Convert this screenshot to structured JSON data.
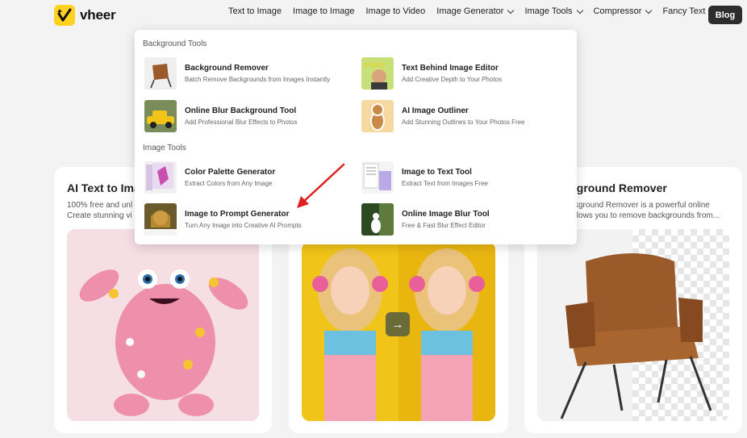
{
  "nav": {
    "brand": "vheer",
    "links": [
      {
        "label": "Text to Image"
      },
      {
        "label": "Image to Image"
      },
      {
        "label": "Image to Video"
      },
      {
        "label": "Image Generator"
      },
      {
        "label": "Image Tools"
      },
      {
        "label": "Compressor"
      },
      {
        "label": "Fancy Text"
      }
    ],
    "blog_label": "Blog"
  },
  "dropdown": {
    "background_tools_title": "Background Tools",
    "image_tools_title": "Image Tools",
    "background_tools": [
      {
        "title": "Background Remover",
        "desc": "Batch Remove Backgrounds from Images Instantly",
        "icon": "chair-thumbnail"
      },
      {
        "title": "Text Behind Image Editor",
        "desc": "Add Creative Depth to Your Photos",
        "icon": "portrait-text-thumbnail"
      },
      {
        "title": "Online Blur Background Tool",
        "desc": "Add Professional Blur Effects to Photos",
        "icon": "yellow-car-thumbnail"
      },
      {
        "title": "AI Image Outliner",
        "desc": "Add Stunning Outlines to Your Photos Free",
        "icon": "cat-outline-thumbnail"
      }
    ],
    "image_tools": [
      {
        "title": "Color Palette Generator",
        "desc": "Extract Colors from Any Image",
        "icon": "palette-thumbnail"
      },
      {
        "title": "Image to Text Tool",
        "desc": "Extract Text from Images Free",
        "icon": "document-thumbnail"
      },
      {
        "title": "Image to Prompt Generator",
        "desc": "Turn Any Image into Creative AI Prompts",
        "icon": "portrait-prompt-thumbnail"
      },
      {
        "title": "Online Image Blur Tool",
        "desc": "Free & Fast Blur Effect Editor",
        "icon": "blur-thumbnail"
      }
    ]
  },
  "cards": [
    {
      "title": "AI Text to Ima",
      "desc_line1": "100% free and unl",
      "desc_line2": "Create stunning vi"
    },
    {
      "title": "",
      "desc_line1": "",
      "desc_line2": ""
    },
    {
      "title": "kground Remover",
      "desc_line1": "ckground Remover is a powerful online",
      "desc_line2": "allows you to remove backgrounds from..."
    }
  ],
  "colors": {
    "brand_yellow": "#ffd21f",
    "blog_bg": "#2d2d2d",
    "annotation_red": "#e02020"
  }
}
